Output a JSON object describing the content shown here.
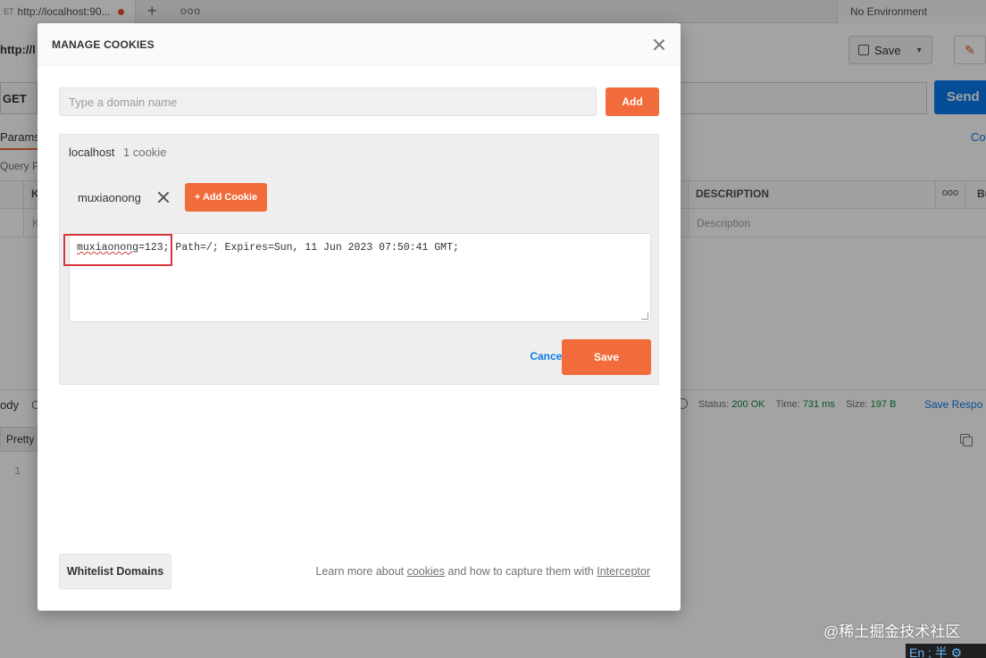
{
  "app": {
    "tab": {
      "method": "ET",
      "url": "http://localhost:90..."
    },
    "new_tab": "+",
    "more_tabs": "ooo",
    "environment": "No Environment",
    "url_title": "http://l",
    "save_label": "Save",
    "method": "GET",
    "send_label": "Send",
    "params_tab": "Params",
    "cookies_link": "Co",
    "query_params_label": "Query P",
    "table": {
      "key_header": "K",
      "description_header": "DESCRIPTION",
      "more_header": "ooo",
      "bulk_header": "Bu",
      "key_placeholder": "K",
      "description_placeholder": "Description"
    },
    "response": {
      "body_tab": "ody",
      "second_tab": "C",
      "status_label": "Status:",
      "status_value": "200 OK",
      "time_label": "Time:",
      "time_value": "731 ms",
      "size_label": "Size:",
      "size_value": "197 B",
      "save_response": "Save Respo",
      "pretty": "Pretty",
      "line_number": "1"
    }
  },
  "modal": {
    "title": "MANAGE COOKIES",
    "domain_placeholder": "Type a domain name",
    "add_label": "Add",
    "domain": {
      "name": "localhost",
      "count": "1 cookie"
    },
    "cookie_chip": "muxiaonong",
    "add_cookie_label": "+ Add Cookie",
    "cookie_value": {
      "name": "muxiaonong",
      "rest": "=123; Path=/; Expires=Sun, 11 Jun 2023 07:50:41 GMT;"
    },
    "cancel_label": "Cancel",
    "save_label": "Save",
    "whitelist_label": "Whitelist Domains",
    "learn_more": {
      "prefix": "Learn more about ",
      "link1": "cookies",
      "middle": " and how to capture them with ",
      "link2": "Interceptor"
    }
  },
  "watermark": "@稀土掘金技术社区",
  "ime": "En ; 半 ⚙",
  "colors": {
    "accent": "#f26b3a",
    "link": "#097bed",
    "send": "#097bed",
    "highlight": "#d9363e",
    "status_ok": "#0c8a3b"
  }
}
